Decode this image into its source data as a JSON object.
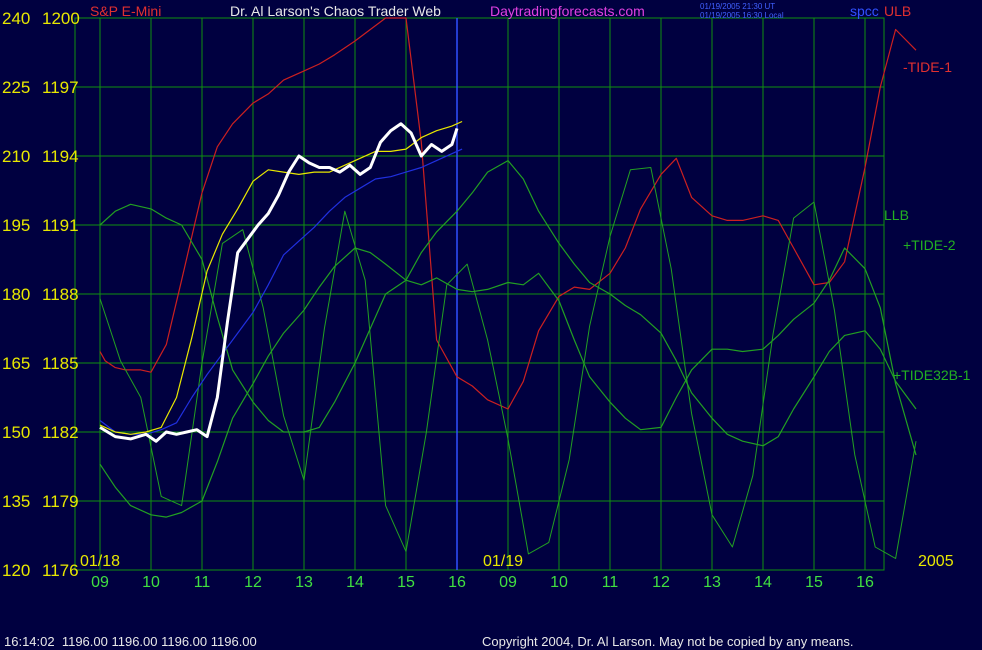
{
  "header": {
    "instrument": "S&P E-Mini",
    "site_title": "Dr. Al Larson's Chaos Trader Web",
    "site_url": "Daytradingforecasts.com",
    "time_ut": "01/19/2005 21:30 UT",
    "time_local": "01/19/2005 16:30 Local",
    "symbol": "spcc",
    "corner_tag": "ULB"
  },
  "footer": {
    "quote": "16:14:02  1196.00 1196.00 1196.00 1196.00",
    "copyright": "Copyright 2004, Dr. Al Larson. May not be copied by any means."
  },
  "colors": {
    "background": "#000040",
    "grid": "#109010",
    "price": "#ffffff",
    "red_tide": "#cc2020",
    "green_tide": "#22a022",
    "blue_line": "#2030e0",
    "yellow_line": "#e8e800",
    "axis_text": "#e8e800",
    "hour_text": "#40e040"
  },
  "chart_data": {
    "type": "line",
    "y_axis_left_outer": [
      240,
      225,
      210,
      195,
      180,
      165,
      150,
      135,
      120
    ],
    "y_axis_left_inner": [
      1200,
      1197,
      1194,
      1191,
      1188,
      1185,
      1182,
      1179,
      1176
    ],
    "x_tick_labels": [
      "09",
      "10",
      "11",
      "12",
      "13",
      "14",
      "15",
      "16",
      "09",
      "10",
      "11",
      "12",
      "13",
      "14",
      "15",
      "16"
    ],
    "date_labels": [
      "01/18",
      "01/19"
    ],
    "year_label": "2005",
    "ylim": [
      1176,
      1200
    ],
    "grid": true,
    "series": [
      {
        "name": "-TIDE-1",
        "x": [
          0,
          0.1,
          0.3,
          0.5,
          0.8,
          1.0,
          1.3,
          1.6,
          2.0,
          2.3,
          2.6,
          3.0,
          3.3,
          3.6,
          4.0,
          4.3,
          4.6,
          5.0,
          5.3,
          5.6,
          6.0,
          6.3,
          6.6,
          7.0,
          7.3,
          7.6,
          8.0,
          8.3,
          8.6,
          9.0,
          9.3,
          9.6,
          10.0,
          10.3,
          10.6,
          11.0,
          11.3,
          11.6,
          12.0,
          12.3,
          12.6,
          13.0,
          13.3,
          13.6,
          14.0,
          14.3,
          14.6,
          15.0,
          15.3,
          15.6,
          16.0
        ],
        "values": [
          1185.5,
          1185.1,
          1184.8,
          1184.7,
          1184.7,
          1184.6,
          1185.8,
          1188.6,
          1192.4,
          1194.4,
          1195.4,
          1196.3,
          1196.7,
          1197.3,
          1197.7,
          1198.0,
          1198.4,
          1199.0,
          1199.5,
          1200.0,
          1200.0,
          1194.6,
          1186.0,
          1184.4,
          1184.0,
          1183.4,
          1183.0,
          1184.2,
          1186.4,
          1187.9,
          1188.3,
          1188.2,
          1188.9,
          1190.0,
          1191.7,
          1193.2,
          1193.9,
          1192.2,
          1191.4,
          1191.2,
          1191.2,
          1191.4,
          1191.2,
          1190.0,
          1188.4,
          1188.5,
          1189.4,
          1193.5,
          1197.0,
          1199.5,
          1198.6
        ]
      },
      {
        "name": "+TIDE-2",
        "x": [
          0,
          0.3,
          0.6,
          1.0,
          1.3,
          1.6,
          2.0,
          2.3,
          2.6,
          3.0,
          3.3,
          3.6,
          4.0,
          4.3,
          4.6,
          5.0,
          5.3,
          5.6,
          6.0,
          6.3,
          6.6,
          7.0,
          7.3,
          7.6,
          8.0,
          8.3,
          8.6,
          9.0,
          9.3,
          9.6,
          10.0,
          10.3,
          10.6,
          11.0,
          11.3,
          11.6,
          12.0,
          12.3,
          12.6,
          13.0,
          13.3,
          13.6,
          14.0,
          14.3,
          14.6,
          15.0,
          15.3,
          15.6,
          16.0
        ],
        "values": [
          1191.0,
          1191.6,
          1191.9,
          1191.7,
          1191.3,
          1191.0,
          1189.5,
          1187.0,
          1184.7,
          1183.3,
          1182.5,
          1182.0,
          1182.0,
          1182.2,
          1183.3,
          1185.0,
          1186.5,
          1188.0,
          1188.6,
          1189.8,
          1190.7,
          1191.6,
          1192.4,
          1193.3,
          1193.8,
          1193.0,
          1191.6,
          1190.2,
          1189.3,
          1188.5,
          1188.0,
          1187.5,
          1187.1,
          1186.3,
          1185.1,
          1183.7,
          1182.6,
          1181.9,
          1181.6,
          1181.4,
          1181.8,
          1183.0,
          1184.4,
          1185.5,
          1186.2,
          1186.4,
          1185.6,
          1184.2,
          1183.0
        ]
      },
      {
        "name": "+TIDE32B-1",
        "x": [
          0,
          0.3,
          0.6,
          1.0,
          1.3,
          1.6,
          2.0,
          2.3,
          2.6,
          3.0,
          3.3,
          3.6,
          4.0,
          4.3,
          4.6,
          5.0,
          5.3,
          5.6,
          6.0,
          6.3,
          6.6,
          7.0,
          7.3,
          7.6,
          8.0,
          8.3,
          8.6,
          9.0,
          9.3,
          9.6,
          10.0,
          10.3,
          10.6,
          11.0,
          11.3,
          11.6,
          12.0,
          12.3,
          12.6,
          13.0,
          13.3,
          13.6,
          14.0,
          14.3,
          14.6,
          15.0,
          15.3,
          15.6,
          16.0
        ],
        "values": [
          1180.6,
          1179.6,
          1178.8,
          1178.4,
          1178.3,
          1178.5,
          1179.0,
          1180.7,
          1182.6,
          1184.1,
          1185.3,
          1186.3,
          1187.3,
          1188.3,
          1189.2,
          1190.0,
          1189.8,
          1189.3,
          1188.6,
          1188.4,
          1188.7,
          1188.2,
          1188.1,
          1188.2,
          1188.5,
          1188.4,
          1188.9,
          1187.7,
          1186.0,
          1184.4,
          1183.3,
          1182.6,
          1182.1,
          1182.2,
          1183.5,
          1184.7,
          1185.6,
          1185.6,
          1185.5,
          1185.6,
          1186.2,
          1186.9,
          1187.6,
          1188.6,
          1190.0,
          1189.1,
          1187.4,
          1184.1,
          1181.0
        ]
      },
      {
        "name": "LLB",
        "x": [
          0,
          0.4,
          0.8,
          1.2,
          1.6,
          2.0,
          2.4,
          2.8,
          3.2,
          3.6,
          4.0,
          4.4,
          4.8,
          5.2,
          5.6,
          6.0,
          6.4,
          6.8,
          7.2,
          7.6,
          8.0,
          8.4,
          8.8,
          9.2,
          9.6,
          10.0,
          10.4,
          10.8,
          11.2,
          11.6,
          12.0,
          12.4,
          12.8,
          13.2,
          13.6,
          14.0,
          14.4,
          14.8,
          15.2,
          15.6,
          16.0
        ],
        "values": [
          1187.8,
          1185.1,
          1183.5,
          1179.2,
          1178.8,
          1185.0,
          1190.2,
          1190.8,
          1187.4,
          1182.7,
          1179.9,
          1186.5,
          1191.6,
          1188.6,
          1178.8,
          1176.8,
          1182.0,
          1188.4,
          1189.3,
          1186.0,
          1181.7,
          1176.7,
          1177.2,
          1180.8,
          1186.6,
          1190.5,
          1193.4,
          1193.5,
          1189.1,
          1182.8,
          1178.4,
          1177.0,
          1180.1,
          1186.3,
          1191.3,
          1192.0,
          1187.3,
          1181.0,
          1177.0,
          1176.5,
          1181.6
        ]
      },
      {
        "name": "blue",
        "x": [
          0,
          0.3,
          0.6,
          0.9,
          1.2,
          1.5,
          1.8,
          2.1,
          2.4,
          2.7,
          3.0,
          3.3,
          3.6,
          3.9,
          4.2,
          4.5,
          4.8,
          5.1,
          5.4,
          5.7,
          6.0,
          6.3,
          6.6,
          6.9,
          7.1
        ],
        "values": [
          1182.5,
          1182.0,
          1181.9,
          1181.9,
          1182.1,
          1182.4,
          1183.5,
          1184.5,
          1185.4,
          1186.3,
          1187.2,
          1188.4,
          1189.7,
          1190.3,
          1190.9,
          1191.6,
          1192.2,
          1192.6,
          1193.0,
          1193.1,
          1193.3,
          1193.5,
          1193.8,
          1194.1,
          1194.3
        ]
      },
      {
        "name": "yellow",
        "x": [
          0,
          0.3,
          0.6,
          0.9,
          1.2,
          1.5,
          1.8,
          2.1,
          2.4,
          2.7,
          3.0,
          3.3,
          3.6,
          3.9,
          4.2,
          4.5,
          4.8,
          5.1,
          5.4,
          5.7,
          6.0,
          6.3,
          6.6,
          6.9,
          7.1
        ],
        "values": [
          1182.3,
          1182.0,
          1181.9,
          1182.0,
          1182.2,
          1183.5,
          1186.1,
          1189.0,
          1190.6,
          1191.7,
          1192.9,
          1193.4,
          1193.3,
          1193.2,
          1193.3,
          1193.3,
          1193.6,
          1193.9,
          1194.2,
          1194.2,
          1194.3,
          1194.8,
          1195.1,
          1195.3,
          1195.5
        ]
      },
      {
        "name": "price",
        "x": [
          0,
          0.3,
          0.6,
          0.9,
          1.1,
          1.3,
          1.5,
          1.7,
          1.9,
          2.1,
          2.3,
          2.5,
          2.7,
          2.9,
          3.1,
          3.3,
          3.5,
          3.7,
          3.9,
          4.1,
          4.3,
          4.5,
          4.7,
          4.9,
          5.1,
          5.3,
          5.5,
          5.7,
          5.9,
          6.1,
          6.3,
          6.5,
          6.7,
          6.9,
          7.0
        ],
        "values": [
          1182.2,
          1181.8,
          1181.7,
          1181.9,
          1181.6,
          1182.0,
          1181.9,
          1182.0,
          1182.1,
          1181.8,
          1183.5,
          1186.8,
          1189.8,
          1190.4,
          1191.0,
          1191.5,
          1192.3,
          1193.3,
          1194.0,
          1193.7,
          1193.5,
          1193.5,
          1193.3,
          1193.6,
          1193.2,
          1193.5,
          1194.6,
          1195.1,
          1195.4,
          1195.0,
          1194.0,
          1194.5,
          1194.2,
          1194.5,
          1195.2
        ]
      }
    ],
    "curve_labels": [
      "-TIDE-1",
      "LLB",
      "+TIDE-2",
      "+TIDE32B-1"
    ]
  }
}
